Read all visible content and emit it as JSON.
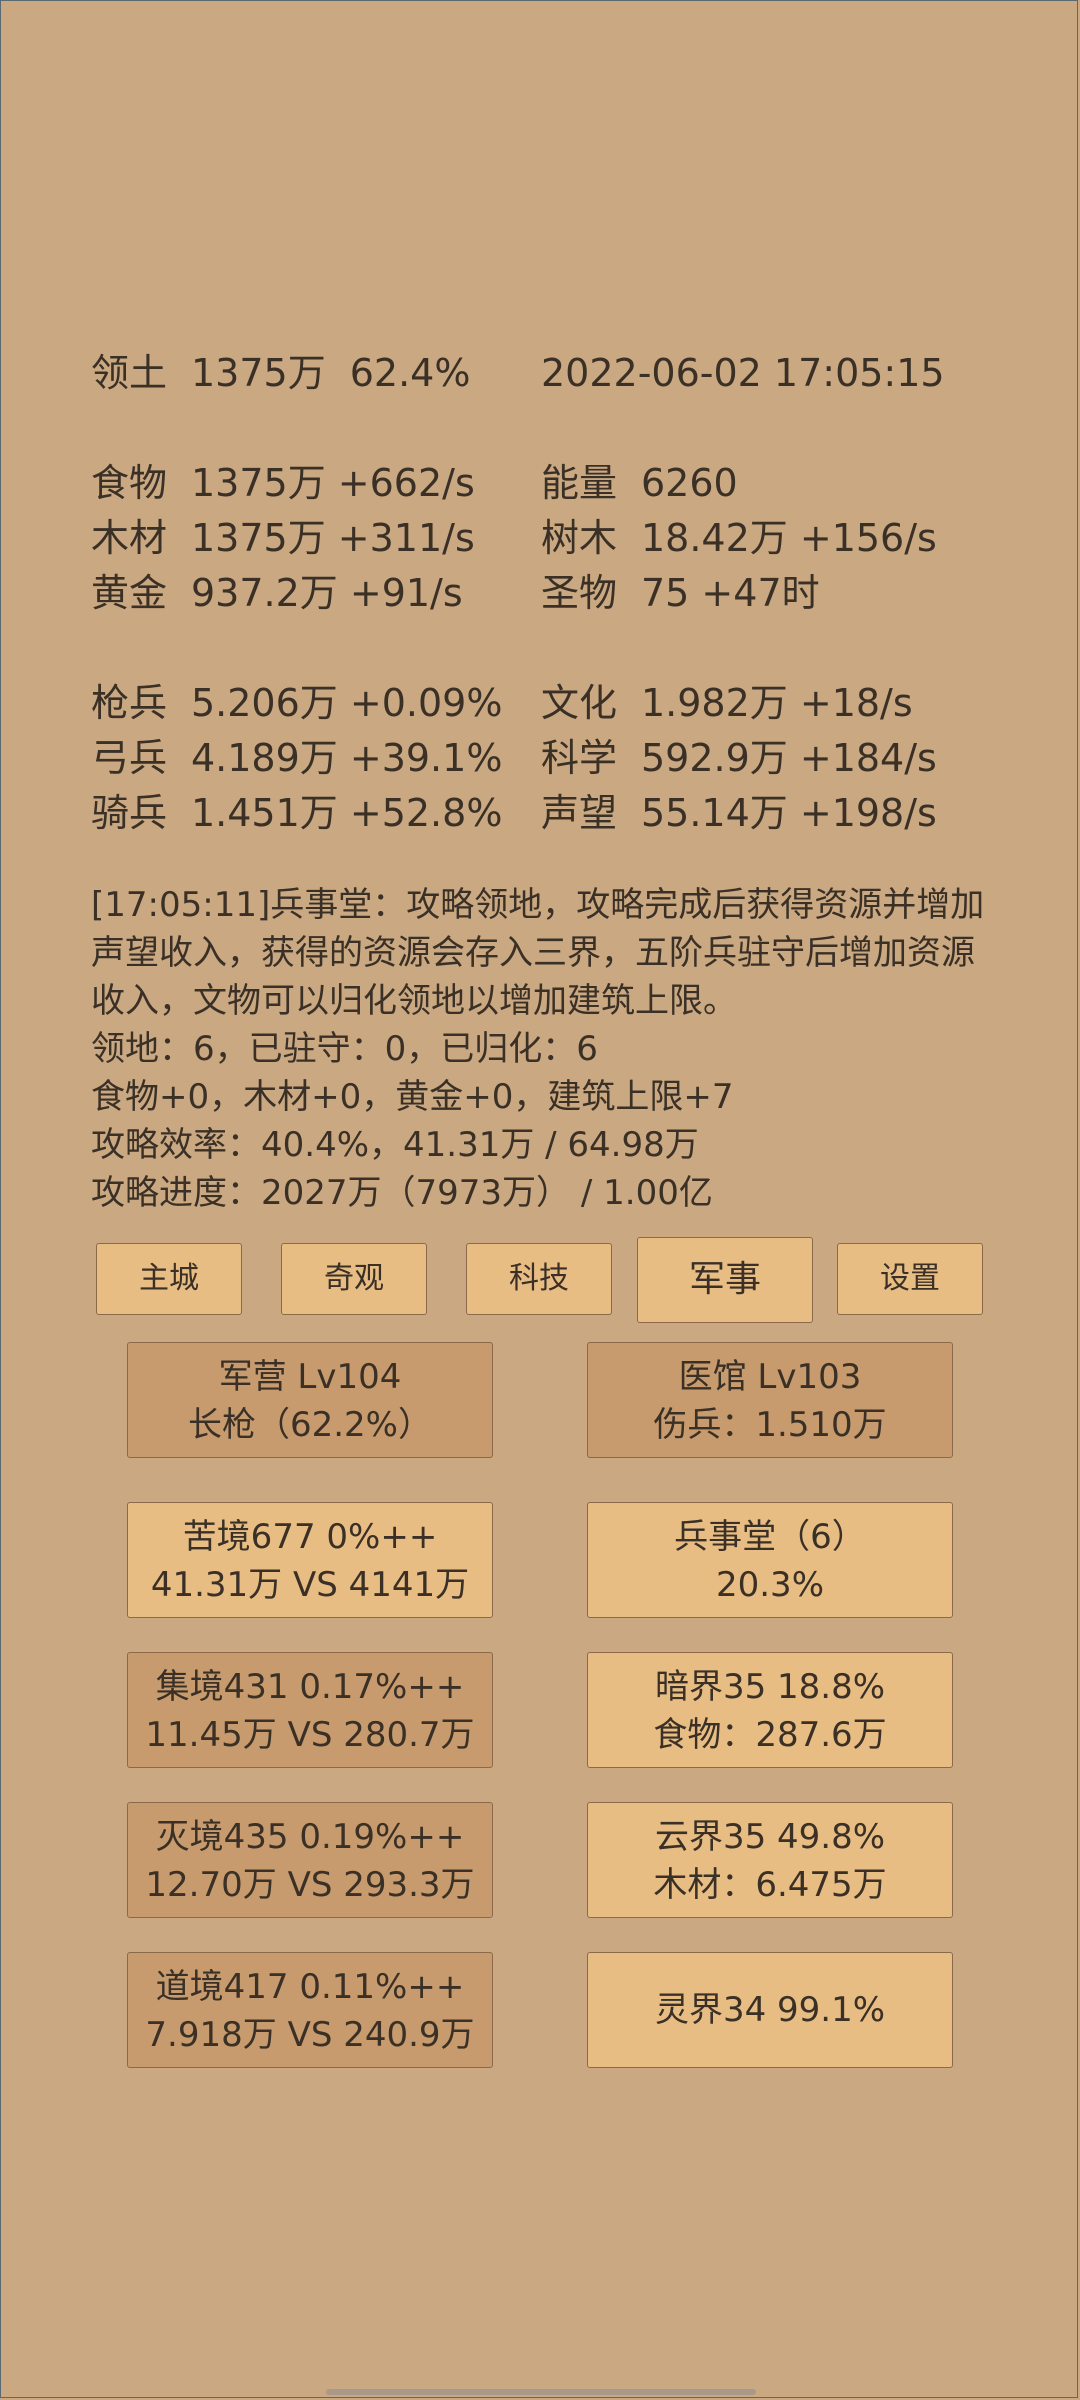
{
  "header": {
    "territory_label": "领土",
    "territory_value": "1375万",
    "territory_pct": "62.4%",
    "datetime": "2022-06-02 17:05:15"
  },
  "resources_left": [
    {
      "label": "食物",
      "value": "1375万 +662/s"
    },
    {
      "label": "木材",
      "value": "1375万 +311/s"
    },
    {
      "label": "黄金",
      "value": "937.2万 +91/s"
    }
  ],
  "resources_right": [
    {
      "label": "能量",
      "value": "6260"
    },
    {
      "label": "树木",
      "value": "18.42万 +156/s"
    },
    {
      "label": "圣物",
      "value": "75 +47时"
    }
  ],
  "troops_left": [
    {
      "label": "枪兵",
      "value": "5.206万 +0.09%"
    },
    {
      "label": "弓兵",
      "value": "4.189万 +39.1%"
    },
    {
      "label": "骑兵",
      "value": "1.451万 +52.8%"
    }
  ],
  "stats_right": [
    {
      "label": "文化",
      "value": "1.982万 +18/s"
    },
    {
      "label": "科学",
      "value": "592.9万 +184/s"
    },
    {
      "label": "声望",
      "value": "55.14万 +198/s"
    }
  ],
  "log": {
    "message": "[17:05:11]兵事堂：攻略领地，攻略完成后获得资源并增加声望收入，获得的资源会存入三界，五阶兵驻守后增加资源收入，文物可以归化领地以增加建筑上限。",
    "territory_status": "领地：6，已驻守：0，已归化：6",
    "bonus": "食物+0，木材+0，黄金+0，建筑上限+7",
    "efficiency": "攻略效率：40.4%，41.31万 / 64.98万",
    "progress": "攻略进度：2027万（7973万） / 1.00亿"
  },
  "tabs": [
    {
      "label": "主城",
      "active": false
    },
    {
      "label": "奇观",
      "active": false
    },
    {
      "label": "科技",
      "active": false
    },
    {
      "label": "军事",
      "active": true
    },
    {
      "label": "设置",
      "active": false
    }
  ],
  "cards": {
    "barracks": {
      "line1": "军营 Lv104",
      "line2": "长枪（62.2%）"
    },
    "clinic": {
      "line1": "医馆 Lv103",
      "line2": "伤兵：1.510万"
    },
    "kujing": {
      "line1": "苦境677  0%++",
      "line2": "41.31万 VS 4141万"
    },
    "bingshitang": {
      "line1": "兵事堂（6）",
      "line2": "20.3%"
    },
    "jijing": {
      "line1": "集境431  0.17%++",
      "line2": "11.45万 VS 280.7万"
    },
    "anjie": {
      "line1": "暗界35  18.8%",
      "line2": "食物：287.6万"
    },
    "miejing": {
      "line1": "灭境435  0.19%++",
      "line2": "12.70万 VS 293.3万"
    },
    "yunjie": {
      "line1": "云界35  49.8%",
      "line2": "木材：6.475万"
    },
    "daojing": {
      "line1": "道境417  0.11%++",
      "line2": "7.918万 VS 240.9万"
    },
    "lingjie": {
      "line1": "灵界34  99.1%"
    }
  },
  "colors": {
    "background": "#c9a882",
    "button": "#e8bd84",
    "card_dark": "#c79b6d",
    "text": "#3a3026",
    "border": "#8a6a4a"
  }
}
